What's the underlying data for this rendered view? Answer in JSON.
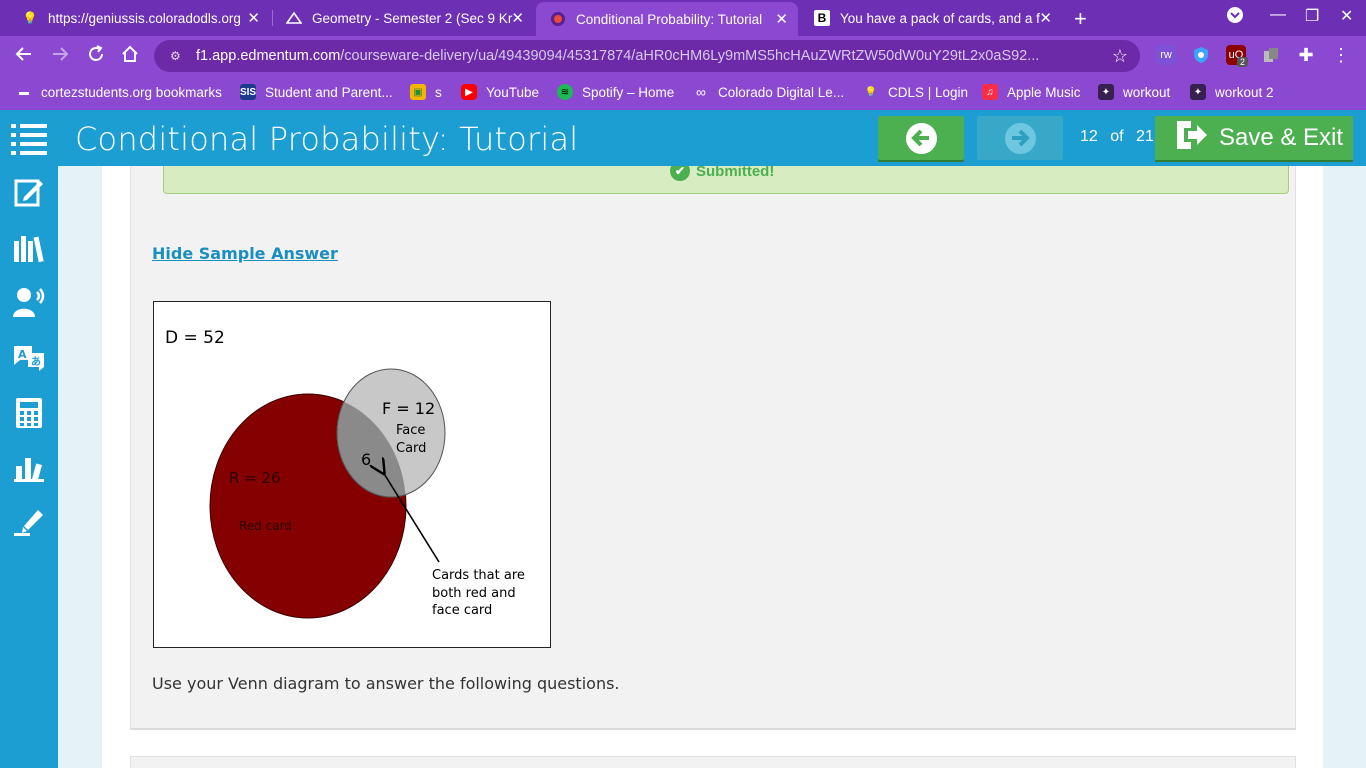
{
  "browser": {
    "tabs": [
      {
        "title": "https://geniussis.coloradodls.org",
        "icon": "lightbulb-icon",
        "active": false
      },
      {
        "title": "Geometry - Semester 2 (Sec 9 Kr",
        "icon": "course-icon",
        "active": false
      },
      {
        "title": "Conditional Probability: Tutorial",
        "icon": "edmentum-icon",
        "active": true
      },
      {
        "title": "You have a pack of cards, and a f",
        "icon": "brainly-icon",
        "active": false
      }
    ],
    "url_host": "f1.app.edmentum.com",
    "url_path": "/courseware-delivery/ua/49439094/45317874/aHR0cHM6Ly9mMS5hcHAuZWRtZW50dW0uY29tL2x0aS92...",
    "bookmarks": [
      {
        "label": "cortezstudents.org bookmarks",
        "icon": "folder-icon"
      },
      {
        "label": "Student and Parent...",
        "icon": "sis-icon"
      },
      {
        "label": "s",
        "icon": "classroom-icon"
      },
      {
        "label": "YouTube",
        "icon": "youtube-icon"
      },
      {
        "label": "Spotify – Home",
        "icon": "spotify-icon"
      },
      {
        "label": "Colorado Digital Le...",
        "icon": "cdl-icon"
      },
      {
        "label": "CDLS | Login",
        "icon": "lightbulb-icon"
      },
      {
        "label": "Apple Music",
        "icon": "music-icon"
      },
      {
        "label": "workout",
        "icon": "workout-icon"
      },
      {
        "label": "workout 2",
        "icon": "workout-icon"
      }
    ],
    "extension_badge": "2"
  },
  "header": {
    "title": "Conditional Probability: Tutorial",
    "page_current": "12",
    "page_of": "of",
    "page_total": "21",
    "save_label": "Save & Exit"
  },
  "content": {
    "submitted_label": "Submitted!",
    "hide_sample_label": "Hide Sample Answer",
    "question_text": "Use your Venn diagram to answer the following questions."
  },
  "venn": {
    "deck_label": "D = 52",
    "red_label": "R = 26",
    "red_desc": "Red card",
    "face_label": "F = 12",
    "face_desc_1": "Face",
    "face_desc_2": "Card",
    "intersection_value": "6",
    "annotation_1": "Cards that are",
    "annotation_2": "both red and",
    "annotation_3": "face card",
    "colors": {
      "red": "#850000",
      "face": "#c8c8c8",
      "overlap": "#8a8a8a"
    }
  }
}
